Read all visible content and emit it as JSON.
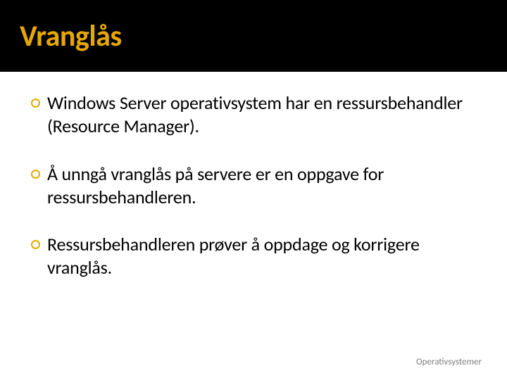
{
  "title": "Vranglås",
  "bullets": [
    "Windows Server operativsystem har en ressursbehandler (Resource Manager).",
    "Å unngå vranglås på servere er en oppgave for ressursbehandleren.",
    "Ressursbehandleren prøver å oppdage og korrigere vranglås."
  ],
  "footer": "Operativsystemer"
}
